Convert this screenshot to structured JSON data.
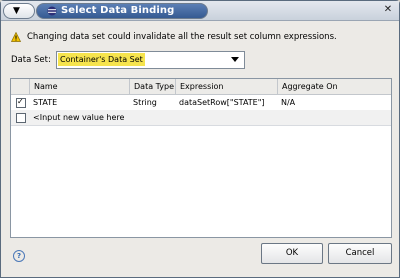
{
  "window": {
    "title": "Select Data Binding",
    "menu_icon": "chevron-down-icon",
    "app_icon": "eclipse-icon",
    "close_icon": "close-icon",
    "close_symbol": "✕"
  },
  "warning": {
    "icon": "warning-icon",
    "text": "Changing data set could invalidate all the result set column expressions."
  },
  "dataset": {
    "label": "Data Set:",
    "value": "Container's Data Set"
  },
  "table": {
    "headers": [
      "",
      "Name",
      "Data Type",
      "Expression",
      "Aggregate On"
    ],
    "rows": [
      {
        "checked": true,
        "name": "STATE",
        "type": "String",
        "expression": "dataSetRow[\"STATE\"]",
        "aggregate": "N/A"
      },
      {
        "checked": false,
        "name": "<Input new value here",
        "type": "",
        "expression": "",
        "aggregate": ""
      }
    ]
  },
  "footer": {
    "help_icon": "help-icon",
    "help_symbol": "?",
    "ok_label": "OK",
    "cancel_label": "Cancel"
  }
}
